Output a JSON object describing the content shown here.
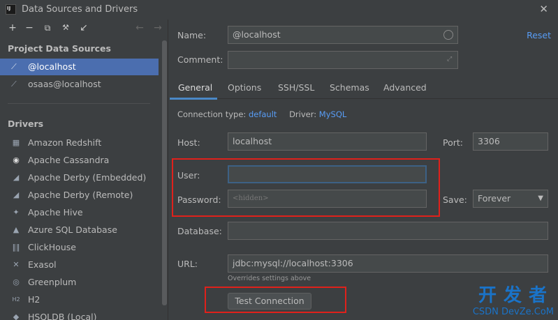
{
  "window": {
    "title": "Data Sources and Drivers"
  },
  "left": {
    "toolbar": {
      "add": "+",
      "remove": "−",
      "copy": "⧉",
      "settings": "🔧",
      "import": "↙",
      "back": "←",
      "forward": "→"
    },
    "project_heading": "Project Data Sources",
    "data_sources": [
      {
        "label": "@localhost"
      },
      {
        "label": "osaas@localhost"
      }
    ],
    "drivers_heading": "Drivers",
    "drivers": [
      {
        "label": "Amazon Redshift"
      },
      {
        "label": "Apache Cassandra"
      },
      {
        "label": "Apache Derby (Embedded)"
      },
      {
        "label": "Apache Derby (Remote)"
      },
      {
        "label": "Apache Hive"
      },
      {
        "label": "Azure SQL Database"
      },
      {
        "label": "ClickHouse"
      },
      {
        "label": "Exasol"
      },
      {
        "label": "Greenplum"
      },
      {
        "label": "H2"
      },
      {
        "label": "HSQLDB (Local)"
      }
    ]
  },
  "form": {
    "name_label": "Name:",
    "name_value": "@localhost",
    "reset": "Reset",
    "comment_label": "Comment:",
    "comment_value": "",
    "tabs": [
      "General",
      "Options",
      "SSH/SSL",
      "Schemas",
      "Advanced"
    ],
    "connection_type_label": "Connection type:",
    "connection_type_value": "default",
    "driver_label": "Driver:",
    "driver_value": "MySQL",
    "host_label": "Host:",
    "host_value": "localhost",
    "port_label": "Port:",
    "port_value": "3306",
    "user_label": "User:",
    "user_value": "",
    "password_label": "Password:",
    "password_placeholder": "<hidden>",
    "save_label": "Save:",
    "save_value": "Forever",
    "database_label": "Database:",
    "database_value": "",
    "url_label": "URL:",
    "url_value": "jdbc:mysql://localhost:3306",
    "url_hint": "Overrides settings above",
    "test_connection": "Test Connection"
  },
  "watermark": {
    "cn": "开发者",
    "sub": "CSDN DevZe.CoM"
  },
  "colors": {
    "accent": "#589df6",
    "selection": "#4b6eaf",
    "highlight": "#e0211b"
  }
}
